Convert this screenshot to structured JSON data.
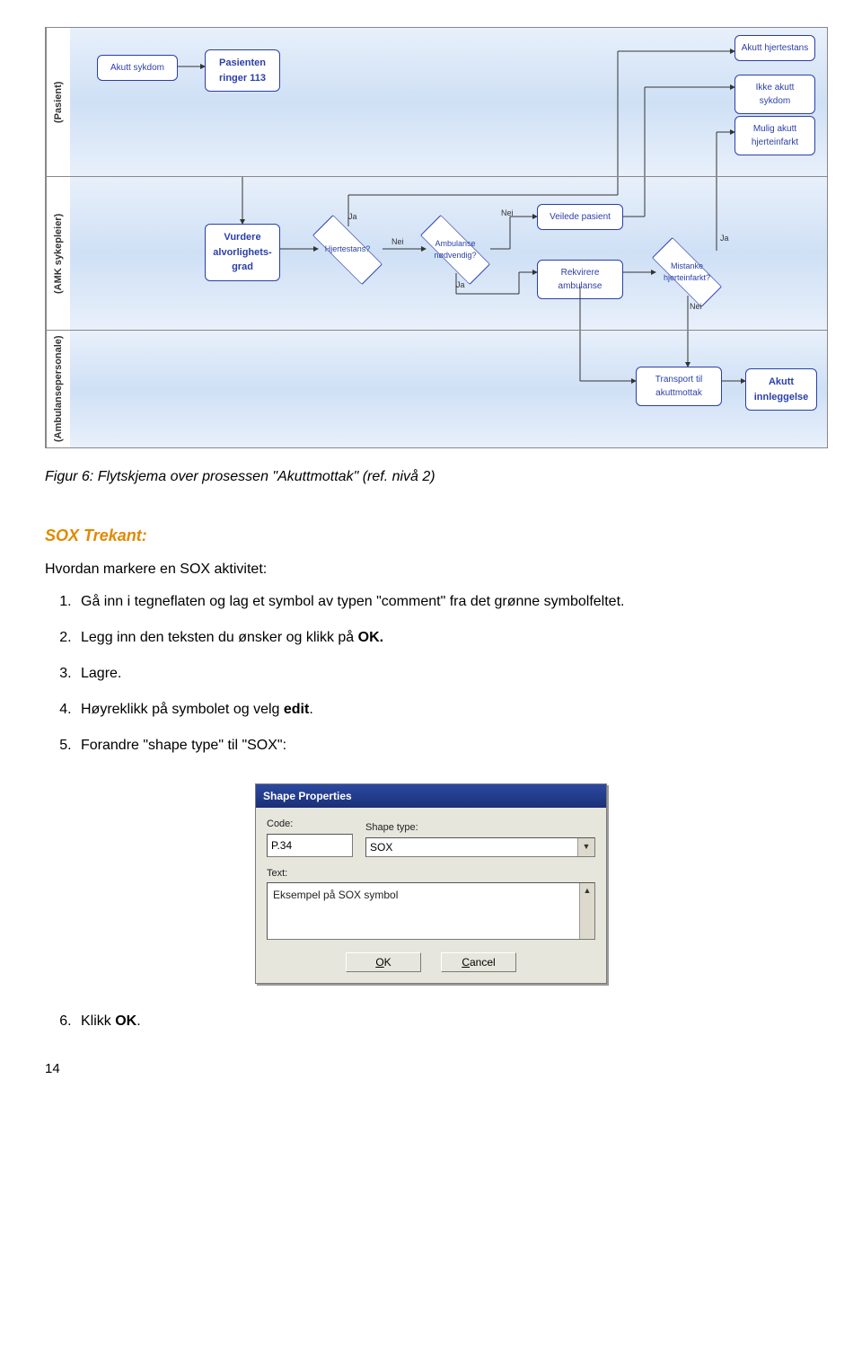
{
  "flowchart": {
    "lanes": {
      "pasient": "(Pasient)",
      "amk": "(AMK sykepleier)",
      "ambulanse": "(Ambulansepersonale)"
    },
    "nodes": {
      "akutt_sykdom": "Akutt sykdom",
      "pasienten_ringer": "Pasienten ringer 113",
      "akutt_hjertestans": "Akutt hjertestans",
      "ikke_akutt_sykdom": "Ikke akutt sykdom",
      "mulig_akutt_hjerteinfarkt": "Mulig akutt hjerteinfarkt",
      "vurdere": "Vurdere alvorlighets-grad",
      "hjertestans": "Hjertestans?",
      "ambulanse_nodv": "Ambulanse nødvendig?",
      "veilede_pasient": "Veilede pasient",
      "rekvirere_ambulanse": "Rekvirere ambulanse",
      "mistanke_hjerteinfarkt": "Mistanke hjerteinfarkt?",
      "transport": "Transport til akuttmottak",
      "akutt_innleggelse": "Akutt innleggelse"
    },
    "labels": {
      "ja": "Ja",
      "nei": "Nei"
    }
  },
  "caption": "Figur 6: Flytskjema over prosessen \"Akuttmottak\" (ref. nivå 2)",
  "section_heading": "SOX Trekant:",
  "intro": "Hvordan markere en SOX aktivitet:",
  "steps": {
    "s1a": "Gå inn i tegneflaten og lag et symbol av typen \"comment\" fra det grønne symbolfeltet.",
    "s2a": "Legg inn den teksten du ønsker og klikk på ",
    "s2b": "OK.",
    "s3": "Lagre.",
    "s4a": "Høyreklikk på symbolet og velg ",
    "s4b": "edit",
    "s4c": ".",
    "s5": "Forandre \"shape type\" til \"SOX\":",
    "s6a": "Klikk ",
    "s6b": "OK",
    "s6c": "."
  },
  "dialog": {
    "title": "Shape Properties",
    "code_label": "Code:",
    "code_value": "P.34",
    "shape_type_label": "Shape type:",
    "shape_type_value": "SOX",
    "text_label": "Text:",
    "text_value": "Eksempel på SOX symbol",
    "ok": "OK",
    "cancel": "Cancel"
  },
  "page_num": "14"
}
